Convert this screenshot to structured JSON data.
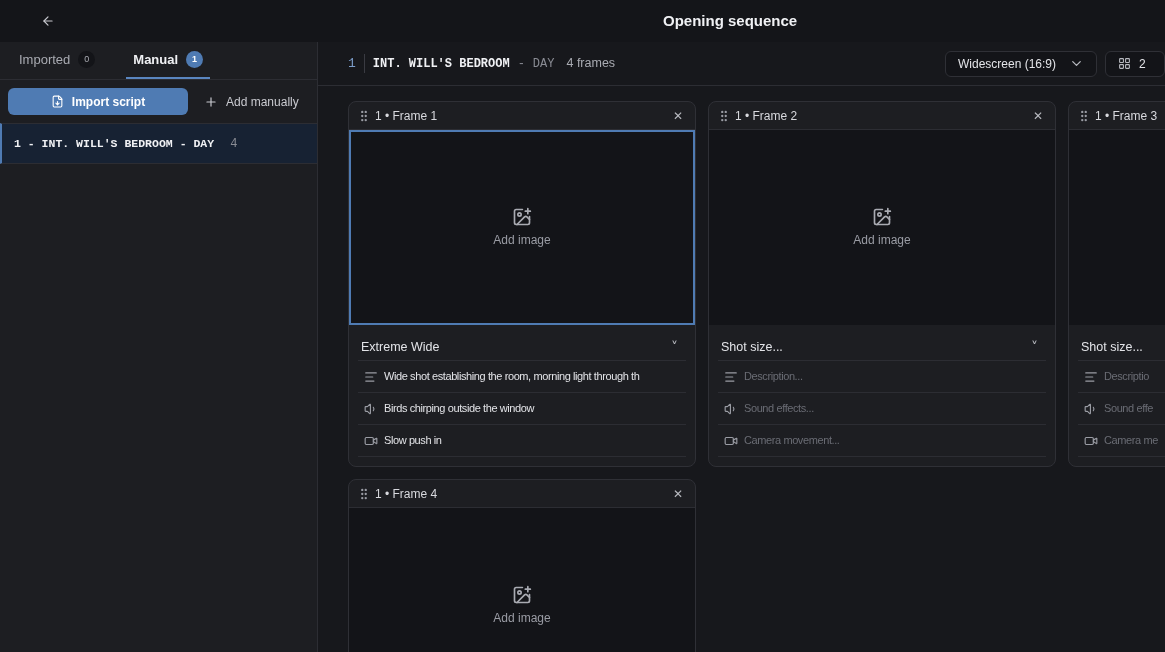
{
  "top_bar": {
    "title": "Opening sequence"
  },
  "sidebar": {
    "tabs": [
      {
        "label": "Imported",
        "count": "0",
        "selected": false
      },
      {
        "label": "Manual",
        "count": "1",
        "selected": true
      }
    ],
    "import_button": "Import script",
    "add_button": "Add manually",
    "scenes": [
      {
        "label": "1 - INT. WILL'S BEDROOM - DAY",
        "count": "4",
        "selected": true
      }
    ]
  },
  "scene_header": {
    "number": "1",
    "location": "INT. WILL'S BEDROOM",
    "separator": "-",
    "time": "DAY",
    "frames": "4 frames",
    "aspect": "Widescreen (16:9)",
    "columns": "2"
  },
  "frames": [
    {
      "title": "1 • Frame 1",
      "close": "✕",
      "image_label": "Add image",
      "selected": true,
      "shot": {
        "value": "Extreme Wide",
        "chevron": "˅"
      },
      "description": {
        "value": "Wide shot establishing the room, morning light through th"
      },
      "sound": {
        "value": "Birds chirping outside the window"
      },
      "camera": {
        "value": "Slow push in"
      }
    },
    {
      "title": "1 • Frame 2",
      "close": "✕",
      "image_label": "Add image",
      "selected": false,
      "shot": {
        "placeholder": "Shot size...",
        "chevron": "˅"
      },
      "description": {
        "placeholder": "Description..."
      },
      "sound": {
        "placeholder": "Sound effects..."
      },
      "camera": {
        "placeholder": "Camera movement..."
      }
    },
    {
      "title": "1 • Frame 3",
      "selected": false,
      "shot": {
        "placeholder": "Shot size..."
      },
      "description": {
        "placeholder": "Descriptio"
      },
      "sound": {
        "placeholder": "Sound effe"
      },
      "camera": {
        "placeholder": "Camera me"
      }
    },
    {
      "title": "1 • Frame 4",
      "close": "✕",
      "image_label": "Add image",
      "selected": false
    }
  ]
}
